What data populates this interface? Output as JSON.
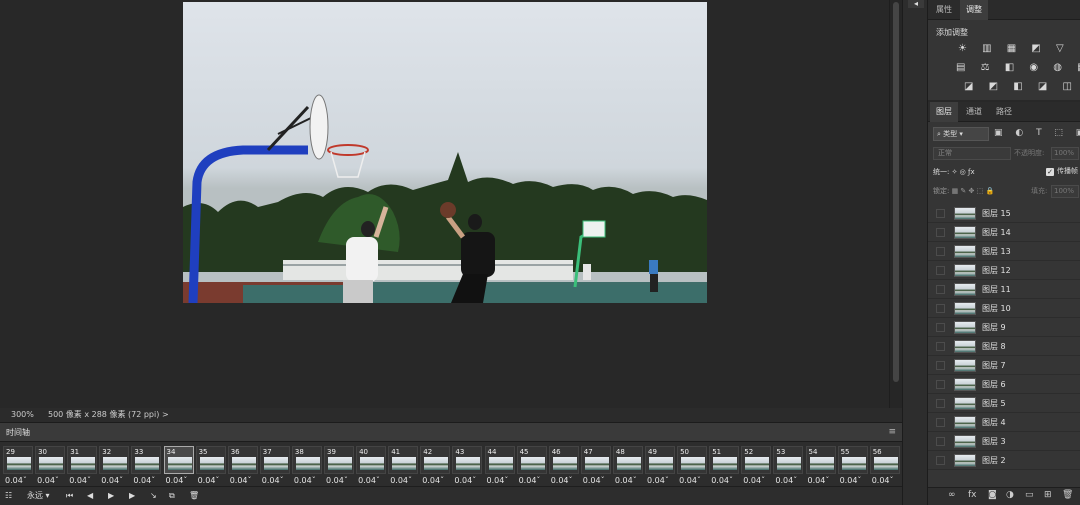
{
  "canvas": {
    "zoom": "300%",
    "doc_info": "500 像素 x 288 像素 (72 ppi)",
    "arrow": ">"
  },
  "timeline": {
    "title": "时间轴",
    "menu_icon": "≡",
    "frames": [
      {
        "num": "29",
        "delay": "0.04"
      },
      {
        "num": "30",
        "delay": "0.04"
      },
      {
        "num": "31",
        "delay": "0.04"
      },
      {
        "num": "32",
        "delay": "0.04"
      },
      {
        "num": "33",
        "delay": "0.04"
      },
      {
        "num": "34",
        "delay": "0.04"
      },
      {
        "num": "35",
        "delay": "0.04"
      },
      {
        "num": "36",
        "delay": "0.04"
      },
      {
        "num": "37",
        "delay": "0.04"
      },
      {
        "num": "38",
        "delay": "0.04"
      },
      {
        "num": "39",
        "delay": "0.04"
      },
      {
        "num": "40",
        "delay": "0.04"
      },
      {
        "num": "41",
        "delay": "0.04"
      },
      {
        "num": "42",
        "delay": "0.04"
      },
      {
        "num": "43",
        "delay": "0.04"
      },
      {
        "num": "44",
        "delay": "0.04"
      },
      {
        "num": "45",
        "delay": "0.04"
      },
      {
        "num": "46",
        "delay": "0.04"
      },
      {
        "num": "47",
        "delay": "0.04"
      },
      {
        "num": "48",
        "delay": "0.04"
      },
      {
        "num": "49",
        "delay": "0.04"
      },
      {
        "num": "50",
        "delay": "0.04"
      },
      {
        "num": "51",
        "delay": "0.04"
      },
      {
        "num": "52",
        "delay": "0.04"
      },
      {
        "num": "53",
        "delay": "0.04"
      },
      {
        "num": "54",
        "delay": "0.04"
      },
      {
        "num": "55",
        "delay": "0.04"
      },
      {
        "num": "56",
        "delay": "0.04"
      }
    ],
    "selected_frame": "34",
    "loop_option": "永远",
    "controls": {
      "convert_icon": "☷",
      "first_icon": "⏮",
      "prev_icon": "◀",
      "play_icon": "▶",
      "next_icon": "▶",
      "tween_icon": "↘",
      "duplicate_icon": "⧉",
      "delete_icon": "🗑"
    }
  },
  "adjust_panel": {
    "tabs": [
      "属性",
      "调整"
    ],
    "active_tab": "调整",
    "add_label": "添加调整",
    "rows": [
      "☀ ▥ ▦ ◩ ▽",
      "▤ ⚖ ◧ ◉ ◍ ▦",
      "◪ ◩ ◧ ◪ ◫"
    ]
  },
  "layers_panel": {
    "tabs": [
      "图层",
      "通道",
      "路径"
    ],
    "active_tab": "图层",
    "filter_label": "⌕ 类型",
    "filter_icons": "▣ ◐ T ⬚ ▣",
    "blend_mode": "正常",
    "opacity_label": "不透明度:",
    "opacity_value": "100%",
    "unify_label": "统一:",
    "propagate_label": "传播帧",
    "lock_label": "锁定:",
    "fill_label": "填充:",
    "fill_value": "100%",
    "layers": [
      "图层 15",
      "图层 14",
      "图层 13",
      "图层 12",
      "图层 11",
      "图层 10",
      "图层 9",
      "图层 8",
      "图层 7",
      "图层 6",
      "图层 5",
      "图层 4",
      "图层 3",
      "图层 2"
    ],
    "footer": {
      "link": "∞",
      "fx": "fx",
      "mask": "◙",
      "adjust": "◑",
      "folder": "▭",
      "new": "⊞",
      "trash": "🗑"
    }
  }
}
